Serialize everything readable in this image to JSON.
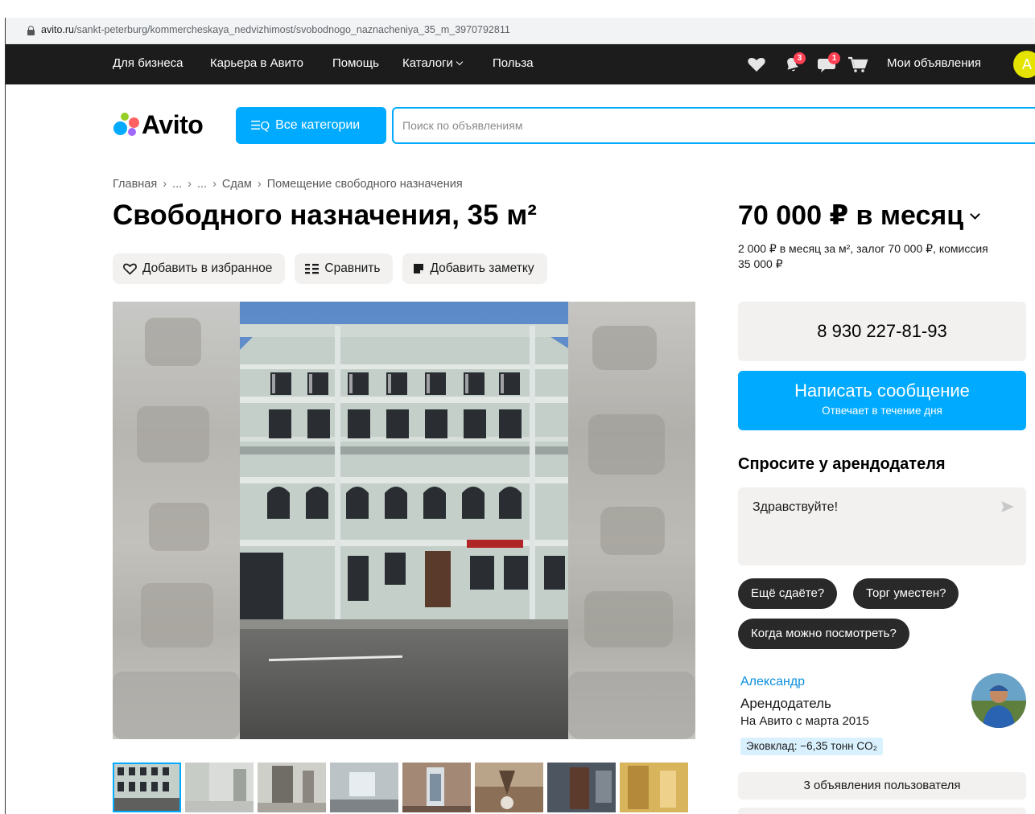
{
  "browser": {
    "url_host": "avito.ru",
    "url_path": "/sankt-peterburg/kommercheskaya_nedvizhimost/svobodnogo_naznacheniya_35_m_3970792811"
  },
  "topnav": {
    "business": "Для бизнеса",
    "career": "Карьера в Авито",
    "help": "Помощь",
    "catalogs": "Каталоги",
    "benefit": "Польза",
    "notifications_count": "3",
    "messages_count": "1",
    "my_ads": "Мои объявления",
    "avatar_letter": "А"
  },
  "header": {
    "logo_text": "Avito",
    "categories_button": "Все категории",
    "search_placeholder": "Поиск по объявлениям"
  },
  "breadcrumb": [
    "Главная",
    "...",
    "...",
    "Сдам",
    "Помещение свободного назначения"
  ],
  "listing": {
    "title": "Свободного назначения, 35 м²",
    "actions": {
      "favorite": "Добавить в избранное",
      "compare": "Сравнить",
      "note": "Добавить заметку"
    },
    "thumbnail_count": 8,
    "active_thumbnail": 0
  },
  "sidebar": {
    "price": "70 000 ₽ в месяц",
    "price_details": "2 000 ₽ в месяц за м², залог 70 000 ₽, комиссия 35 000 ₽",
    "phone": "8 930 227-81-93",
    "message_button": "Написать сообщение",
    "message_subtitle": "Отвечает в течение дня",
    "ask_title": "Спросите у арендодателя",
    "ask_text": "Здравствуйте!",
    "quick_replies": [
      "Ещё сдаёте?",
      "Торг уместен?",
      "Когда можно посмотреть?"
    ],
    "seller": {
      "name": "Александр",
      "role": "Арендодатель",
      "since": "На Авито с марта 2015",
      "eco": "Эковклад: −6,35 тонн CO₂"
    },
    "user_ads": "3 объявления пользователя"
  },
  "colors": {
    "accent": "#00aaff",
    "nav_bg": "#1c1c1c",
    "badge": "#ff4053",
    "chip_bg": "#292929",
    "seller_link": "#0a8edc"
  }
}
